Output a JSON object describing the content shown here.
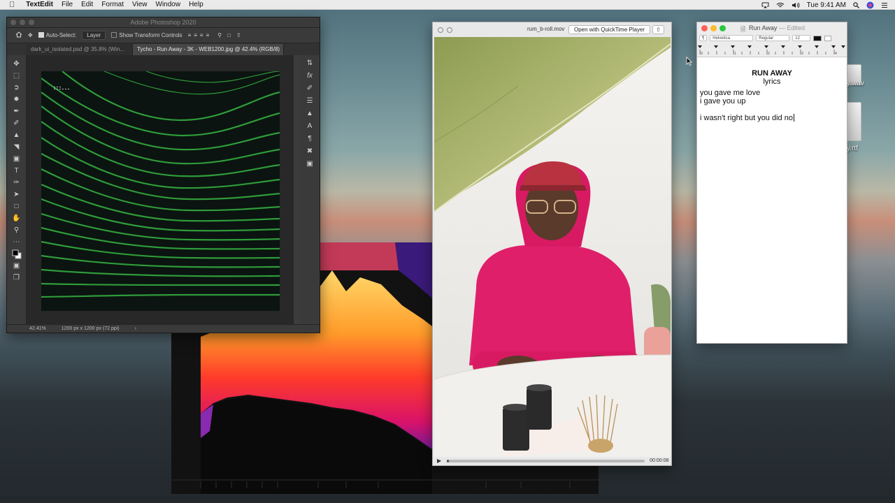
{
  "menubar": {
    "app": "TextEdit",
    "items": [
      "File",
      "Edit",
      "Format",
      "View",
      "Window",
      "Help"
    ],
    "clock": "Tue 9:41 AM"
  },
  "desktop": {
    "file1_suffix": "y.wav",
    "file2_suffix": "y.rtf"
  },
  "photoshop": {
    "window_title": "Adobe Photoshop 2020",
    "options": {
      "auto_select": "Auto-Select:",
      "auto_select_target": "Layer",
      "show_transform": "Show Transform Controls"
    },
    "tabs": [
      {
        "label": "dark_ui_isolated.psd @ 35.8% (Win..."
      },
      {
        "label": "Tycho - Run Away - 3K - WEB1200.jpg @ 42.4% (RGB/8)"
      }
    ],
    "status": {
      "zoom": "42.41%",
      "doc_size": "1200 px x 1200 px (72 ppi)"
    }
  },
  "quicktime": {
    "file_name": "rum_b-roll.mov",
    "open_button": "Open with QuickTime Player",
    "time": "00:00:08",
    "progress": 0.01
  },
  "textedit": {
    "title": "Run Away",
    "edited": "— Edited",
    "font_family": "Helvetica",
    "font_style": "Regular",
    "font_size": "12",
    "doc": {
      "heading": "RUN AWAY",
      "subheading": "lyrics",
      "line1": "you gave me love",
      "line2": "i gave you up",
      "line3": "i wasn't right but you did no"
    },
    "ruler_numbers": [
      "0",
      "1",
      "2",
      "3",
      "4"
    ]
  }
}
